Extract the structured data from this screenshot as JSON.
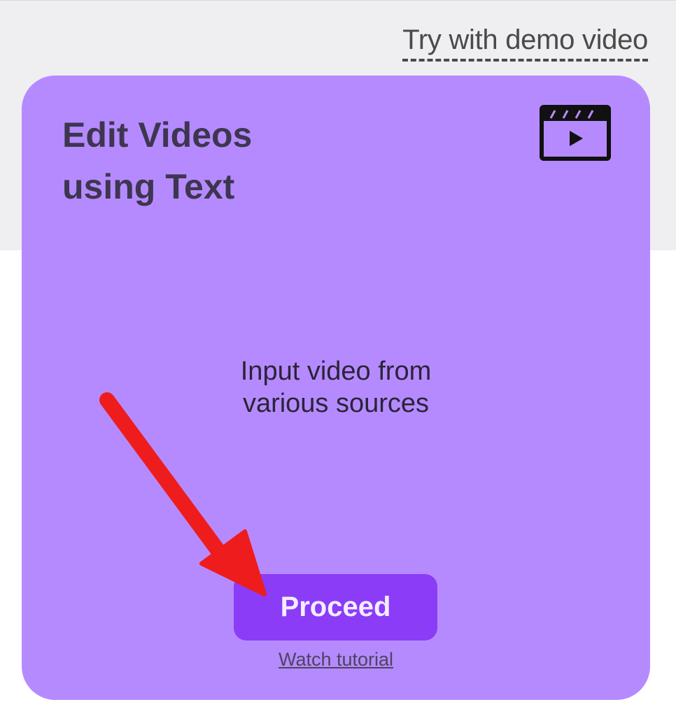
{
  "header": {
    "demo_link_label": "Try with demo video"
  },
  "card": {
    "title_line1": "Edit Videos",
    "title_line2": "using Text",
    "icon": "video-clapperboard-icon",
    "description_line1": "Input video from",
    "description_line2": "various sources",
    "proceed_label": "Proceed",
    "tutorial_label": "Watch tutorial"
  },
  "annotation": {
    "icon": "red-arrow-icon"
  },
  "colors": {
    "card_bg": "#b68aff",
    "button_bg": "#8b3cf7",
    "band_bg": "#efeef1",
    "arrow": "#ee1c1c"
  }
}
